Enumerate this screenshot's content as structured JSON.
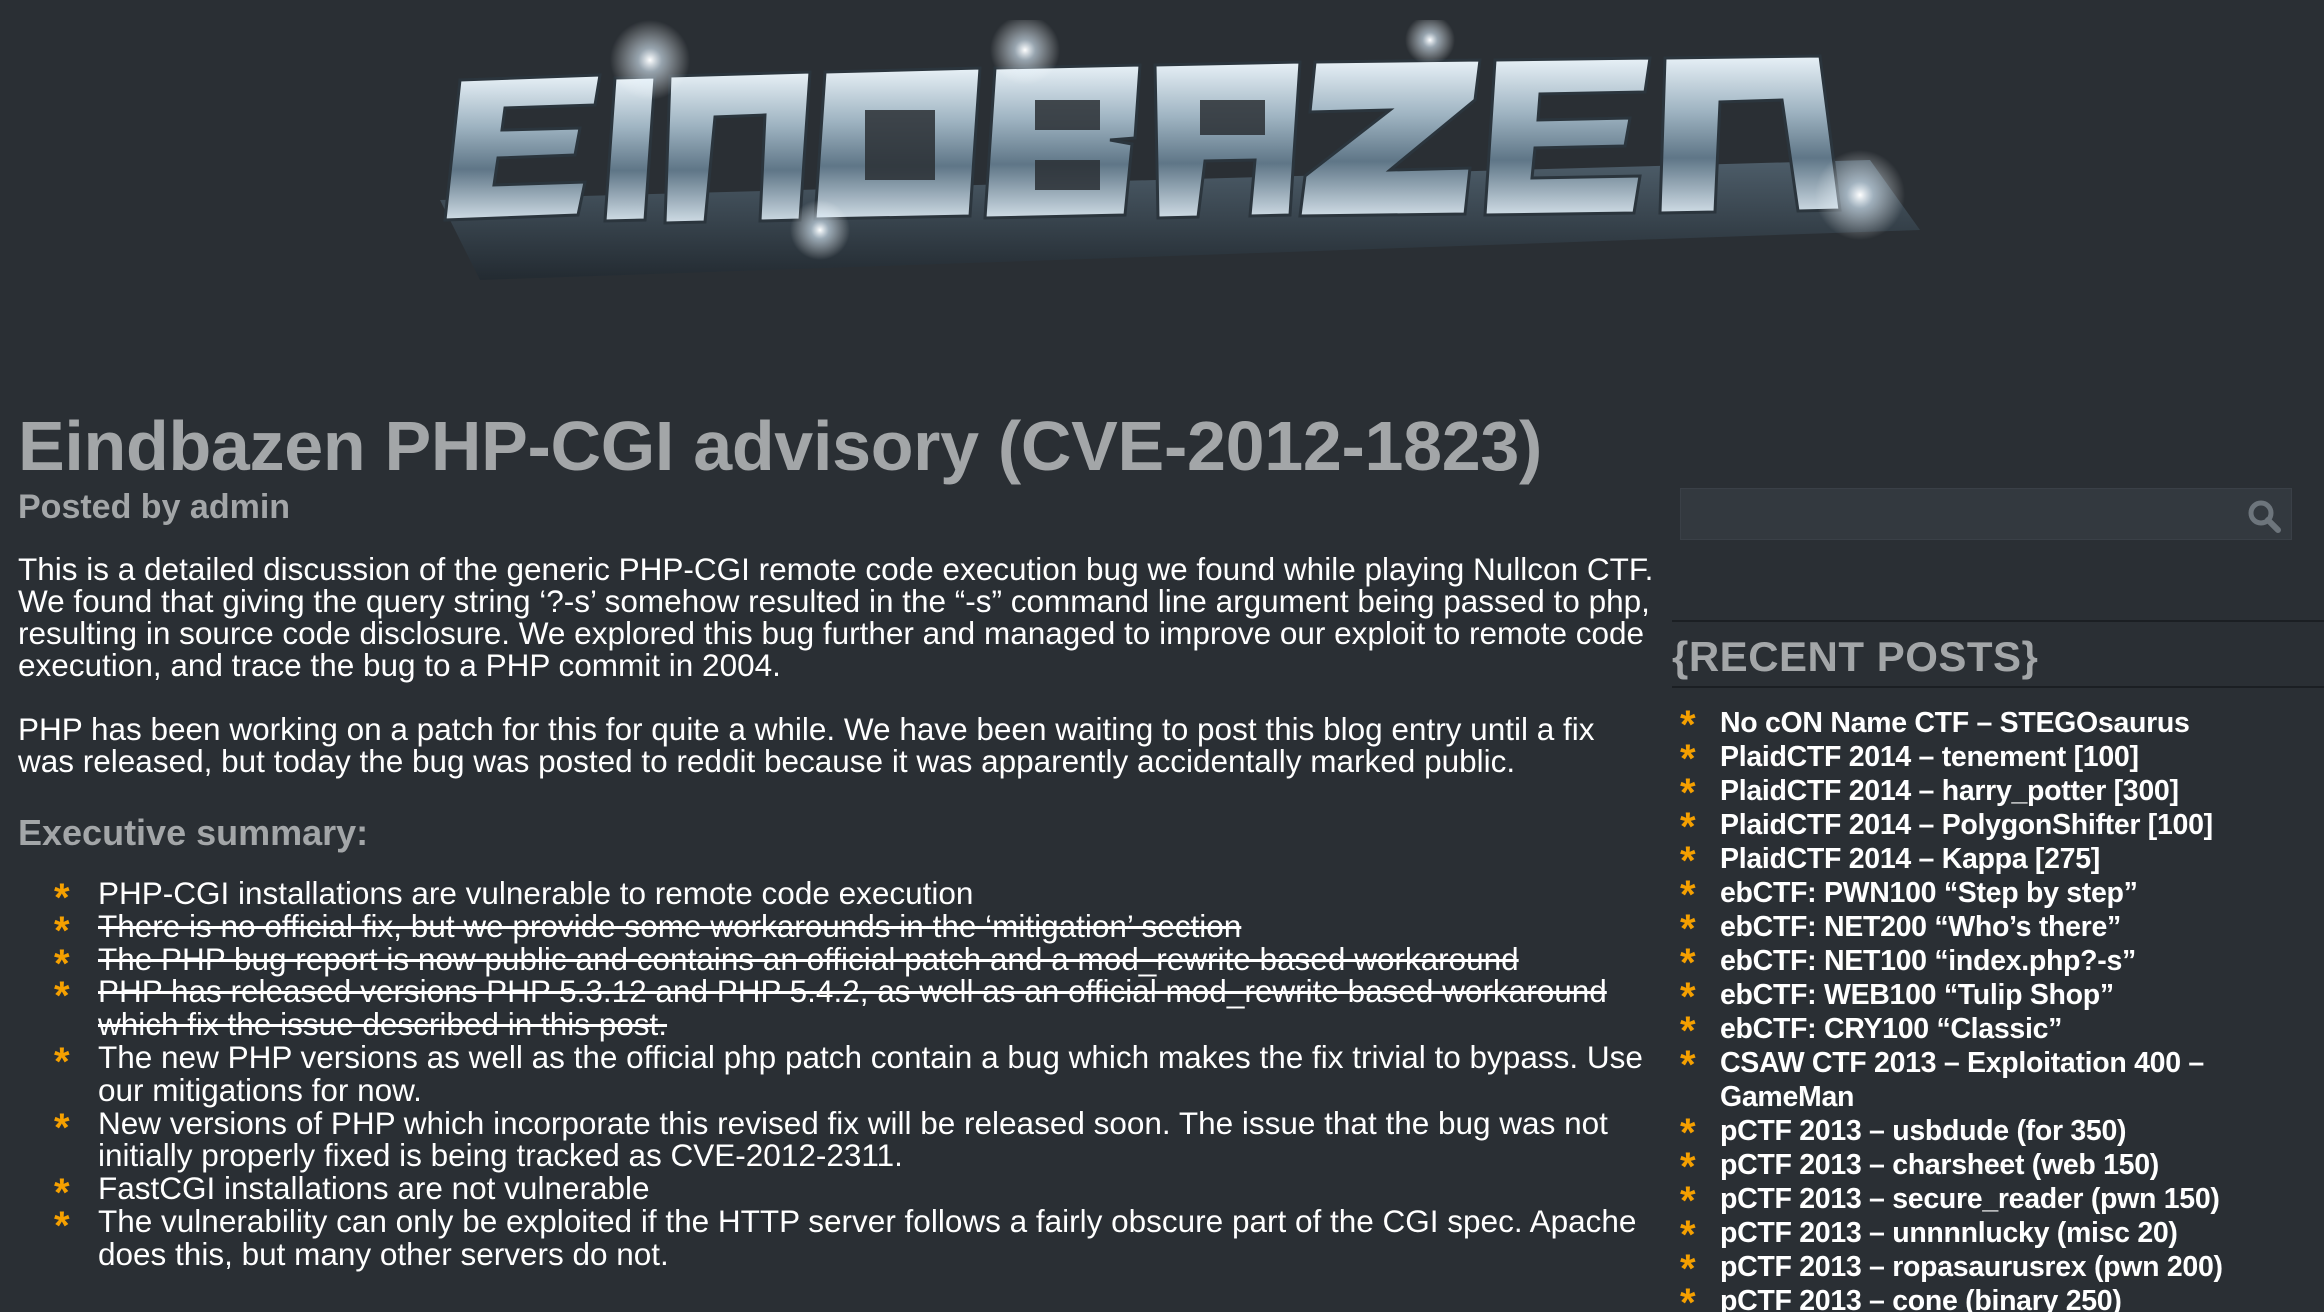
{
  "site": {
    "logo_text": "EINDBAZEN"
  },
  "post": {
    "title": "Eindbazen PHP-CGI advisory (CVE-2012-1823)",
    "meta": "Posted by admin",
    "paragraphs": [
      "This is a detailed discussion of the generic PHP-CGI remote code execution bug we found while playing Nullcon CTF. We found that giving the query string ‘?-s’ somehow resulted in the “-s” command line argument being passed to php, resulting in source code disclosure. We explored this bug further and managed to improve our exploit to remote code execution, and trace the bug to a PHP commit in 2004.",
      "PHP has been working on a patch for this for quite a while. We have been waiting to post this blog entry until a fix was released, but today the bug was posted to reddit because it was apparently accidentally marked public."
    ],
    "summary_heading": "Executive summary:",
    "summary_items": [
      "PHP-CGI installations are vulnerable to remote code execution",
      "There is no official fix, but we provide some workarounds in the ‘mitigation’ section",
      "The PHP bug report is now public and contains an official patch and a mod_rewrite based workaround",
      "PHP has released versions PHP 5.3.12 and PHP 5.4.2, as well as an official mod_rewrite based workaround which fix the issue described in this post.",
      "The new PHP versions as well as the official php patch contain a bug which makes the fix trivial to bypass. Use our mitigations for now.",
      "New versions of PHP which incorporate this revised fix will be released soon. The issue that the bug was not initially properly fixed is being tracked as CVE-2012-2311.",
      "FastCGI installations are not vulnerable",
      "The vulnerability can only be exploited if the HTTP server follows a fairly obscure part of the CGI spec. Apache does this, but many other servers do not."
    ],
    "struck_items": [
      1,
      2,
      3
    ]
  },
  "sidebar": {
    "search": {
      "value": "",
      "icon": "search-icon"
    },
    "recent_heading": "{RECENT POSTS}",
    "recent_posts": [
      "No cON Name CTF – STEGOsaurus",
      "PlaidCTF 2014 – tenement [100]",
      "PlaidCTF 2014 – harry_potter [300]",
      "PlaidCTF 2014 – PolygonShifter [100]",
      "PlaidCTF 2014 – Kappa [275]",
      "ebCTF: PWN100 “Step by step”",
      "ebCTF: NET200 “Who’s there”",
      "ebCTF: NET100 “index.php?-s”",
      "ebCTF: WEB100 “Tulip Shop”",
      "ebCTF: CRY100 “Classic”",
      "CSAW CTF 2013 – Exploitation 400 – GameMan",
      "pCTF 2013 – usbdude (for 350)",
      "pCTF 2013 – charsheet (web 150)",
      "pCTF 2013 – secure_reader (pwn 150)",
      "pCTF 2013 – unnnnlucky (misc 20)",
      "pCTF 2013 – ropasaurusrex (pwn 200)",
      "pCTF 2013 – cone (binary 250)"
    ]
  },
  "colors": {
    "background": "#2a2f34",
    "heading_gray": "#a3a6a8",
    "bullet_orange": "#f5a000",
    "text": "#ffffff"
  }
}
